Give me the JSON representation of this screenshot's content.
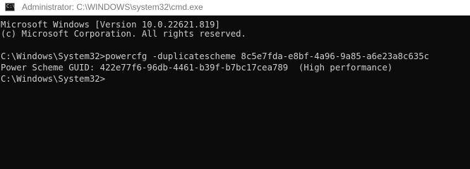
{
  "window": {
    "icon": "cmd-icon",
    "icon_glyph": "C:\\",
    "title": "Administrator: C:\\WINDOWS\\system32\\cmd.exe"
  },
  "console": {
    "lines": [
      "Microsoft Windows [Version 10.0.22621.819]",
      "(c) Microsoft Corporation. All rights reserved.",
      "C:\\Windows\\System32>powercfg -duplicatescheme 8c5e7fda-e8bf-4a96-9a85-a6e23a8c635c",
      "Power Scheme GUID: 422e77f6-96db-4461-b39f-b7bc17cea789  (High performance)",
      "C:\\Windows\\System32>"
    ]
  },
  "colors": {
    "background": "#0c0c0c",
    "text": "#cccccc",
    "titlebar": "#ffffff",
    "title_text": "#7a7a7a"
  }
}
